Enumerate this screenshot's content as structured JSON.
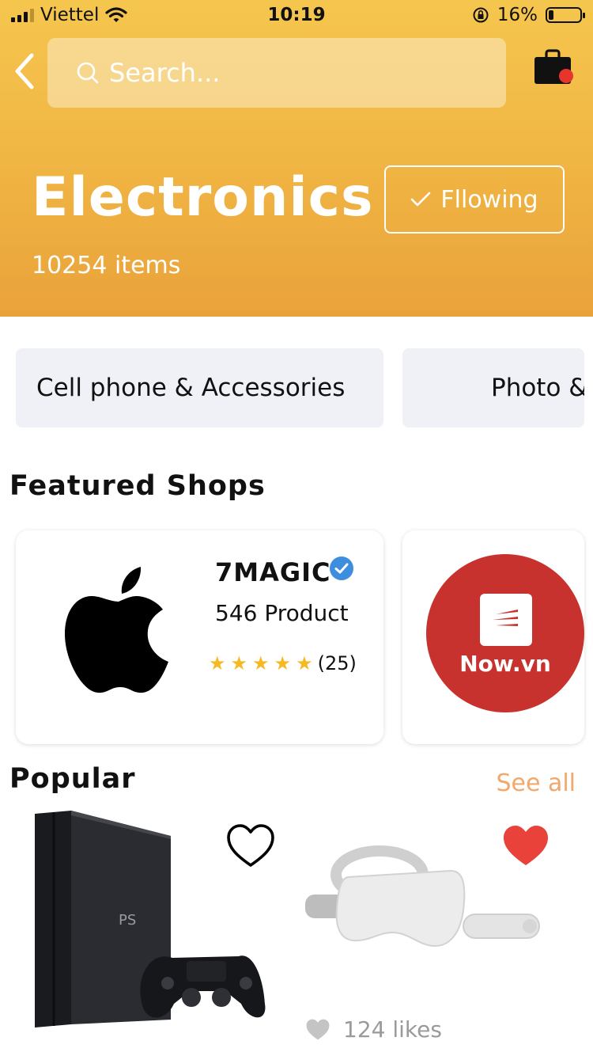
{
  "status_bar": {
    "carrier": "Viettel",
    "time": "10:19",
    "battery": "16%",
    "battery_level": 0.16
  },
  "search": {
    "placeholder": "Search..."
  },
  "category": {
    "title": "Electronics",
    "count": "10254 items",
    "follow_label": "Fllowing"
  },
  "chips": [
    {
      "label": "Cell phone & Accessories"
    },
    {
      "label": "Photo &"
    }
  ],
  "featured": {
    "title": "Featured Shops",
    "shops": [
      {
        "name": "7MAGIC",
        "products": "546 Product",
        "rating_count": "(25)",
        "stars": 5,
        "logo": "apple-logo"
      },
      {
        "name": "Now.vn",
        "logo": "nowvn-logo",
        "color": "#c8322e"
      }
    ]
  },
  "popular": {
    "title": "Popular",
    "see_all": "See all",
    "products": [
      {
        "image": "ps4-console",
        "liked": false
      },
      {
        "image": "vr-headset",
        "liked": true,
        "likes": "124 likes"
      }
    ]
  },
  "colors": {
    "header_top": "#f5c64e",
    "header_bottom": "#e9a23a",
    "accent": "#f2a86b",
    "heart_red": "#e8423b",
    "verified_blue": "#3d8ede",
    "star": "#f5b921"
  }
}
